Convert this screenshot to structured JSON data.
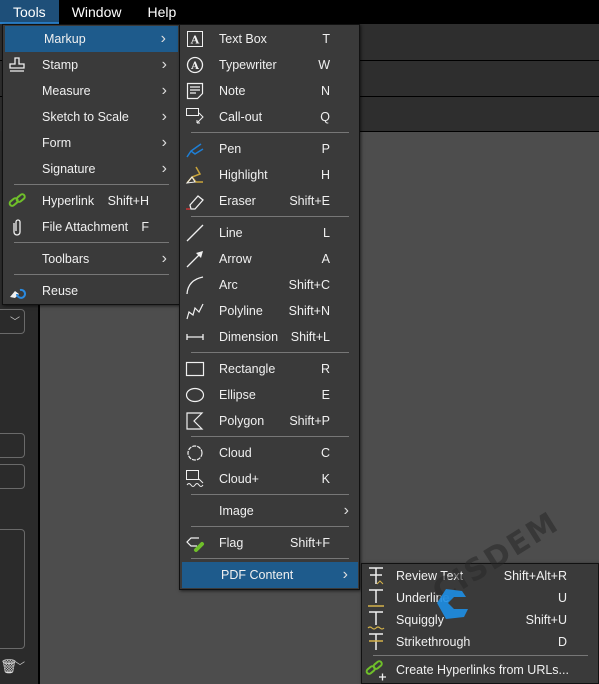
{
  "menubar": {
    "items": [
      {
        "label": "Tools",
        "active": true
      },
      {
        "label": "Window"
      },
      {
        "label": "Help"
      }
    ]
  },
  "accent": "#1e5b8c",
  "tools_menu": {
    "items": [
      {
        "label": "Markup",
        "submenu": true,
        "highlighted": true
      },
      {
        "label": "Stamp",
        "icon": "stamp-icon",
        "submenu": true
      },
      {
        "label": "Measure",
        "submenu": true
      },
      {
        "label": "Sketch to Scale",
        "submenu": true
      },
      {
        "label": "Form",
        "submenu": true
      },
      {
        "label": "Signature",
        "submenu": true
      },
      {
        "separator": true
      },
      {
        "label": "Hyperlink",
        "icon": "link-icon",
        "shortcut": "Shift+H"
      },
      {
        "label": "File Attachment",
        "icon": "paperclip-icon",
        "shortcut": "F"
      },
      {
        "separator": true
      },
      {
        "label": "Toolbars",
        "submenu": true
      },
      {
        "separator": true
      },
      {
        "label": "Reuse",
        "icon": "reuse-icon"
      }
    ]
  },
  "markup_menu": {
    "items": [
      {
        "label": "Text Box",
        "icon": "text-box-icon",
        "shortcut": "T"
      },
      {
        "label": "Typewriter",
        "icon": "typewriter-icon",
        "shortcut": "W"
      },
      {
        "label": "Note",
        "icon": "note-icon",
        "shortcut": "N"
      },
      {
        "label": "Call-out",
        "icon": "callout-icon",
        "shortcut": "Q"
      },
      {
        "separator": true
      },
      {
        "label": "Pen",
        "icon": "pen-icon",
        "shortcut": "P"
      },
      {
        "label": "Highlight",
        "icon": "highlight-icon",
        "shortcut": "H"
      },
      {
        "label": "Eraser",
        "icon": "eraser-icon",
        "shortcut": "Shift+E"
      },
      {
        "separator": true
      },
      {
        "label": "Line",
        "icon": "line-icon",
        "shortcut": "L"
      },
      {
        "label": "Arrow",
        "icon": "arrow-icon",
        "shortcut": "A"
      },
      {
        "label": "Arc",
        "icon": "arc-icon",
        "shortcut": "Shift+C"
      },
      {
        "label": "Polyline",
        "icon": "polyline-icon",
        "shortcut": "Shift+N"
      },
      {
        "label": "Dimension",
        "icon": "dimension-icon",
        "shortcut": "Shift+L"
      },
      {
        "separator": true
      },
      {
        "label": "Rectangle",
        "icon": "rectangle-icon",
        "shortcut": "R"
      },
      {
        "label": "Ellipse",
        "icon": "ellipse-icon",
        "shortcut": "E"
      },
      {
        "label": "Polygon",
        "icon": "polygon-icon",
        "shortcut": "Shift+P"
      },
      {
        "separator": true
      },
      {
        "label": "Cloud",
        "icon": "cloud-icon",
        "shortcut": "C"
      },
      {
        "label": "Cloud+",
        "icon": "cloud-plus-icon",
        "shortcut": "K"
      },
      {
        "separator": true
      },
      {
        "label": "Image",
        "submenu": true
      },
      {
        "separator": true
      },
      {
        "label": "Flag",
        "icon": "flag-icon",
        "shortcut": "Shift+F"
      },
      {
        "separator": true
      },
      {
        "label": "PDF Content",
        "submenu": true,
        "highlighted": true
      }
    ]
  },
  "pdf_content_menu": {
    "items": [
      {
        "label": "Review Text",
        "icon": "review-text-icon",
        "shortcut": "Shift+Alt+R"
      },
      {
        "label": "Underline",
        "icon": "underline-icon",
        "shortcut": "U"
      },
      {
        "label": "Squiggly",
        "icon": "squiggly-icon",
        "shortcut": "Shift+U"
      },
      {
        "label": "Strikethrough",
        "icon": "strikethrough-icon",
        "shortcut": "D"
      },
      {
        "separator": true
      },
      {
        "label": "Create Hyperlinks from URLs...",
        "icon": "create-hyperlinks-icon"
      }
    ]
  },
  "watermark": {
    "text": "CISDEM"
  }
}
